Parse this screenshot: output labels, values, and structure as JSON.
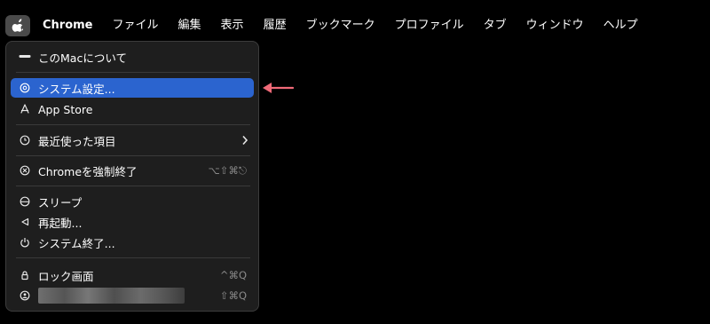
{
  "menubar": {
    "apple_icon": "apple-logo-icon",
    "app_name": "Chrome",
    "items": [
      "ファイル",
      "編集",
      "表示",
      "履歴",
      "ブックマーク",
      "プロファイル",
      "タブ",
      "ウィンドウ",
      "ヘルプ"
    ]
  },
  "apple_menu": {
    "items": [
      {
        "label": "このMacについて",
        "icon": "mac-icon",
        "shortcut": ""
      },
      {
        "label": "システム設定...",
        "icon": "gear-icon",
        "shortcut": "",
        "selected": true
      },
      {
        "label": "App Store",
        "icon": "app-store-icon",
        "shortcut": ""
      },
      {
        "label": "最近使った項目",
        "icon": "clock-icon",
        "shortcut": "",
        "submenu": true
      },
      {
        "label": "Chromeを強制終了",
        "icon": "force-quit-icon",
        "shortcut": "⌥⇧⌘⎋"
      },
      {
        "label": "スリープ",
        "icon": "sleep-icon",
        "shortcut": ""
      },
      {
        "label": "再起動...",
        "icon": "restart-icon",
        "shortcut": ""
      },
      {
        "label": "システム終了...",
        "icon": "power-icon",
        "shortcut": ""
      },
      {
        "label": "ロック画面",
        "icon": "lock-icon",
        "shortcut": "^⌘Q"
      },
      {
        "label": "",
        "icon": "user-icon",
        "shortcut": "⇧⌘Q",
        "redacted": true
      }
    ]
  },
  "colors": {
    "background": "#000000",
    "menu_background": "#1e1e1e",
    "selected_row": "#2b64cf",
    "annotation_arrow": "#f06a78"
  }
}
